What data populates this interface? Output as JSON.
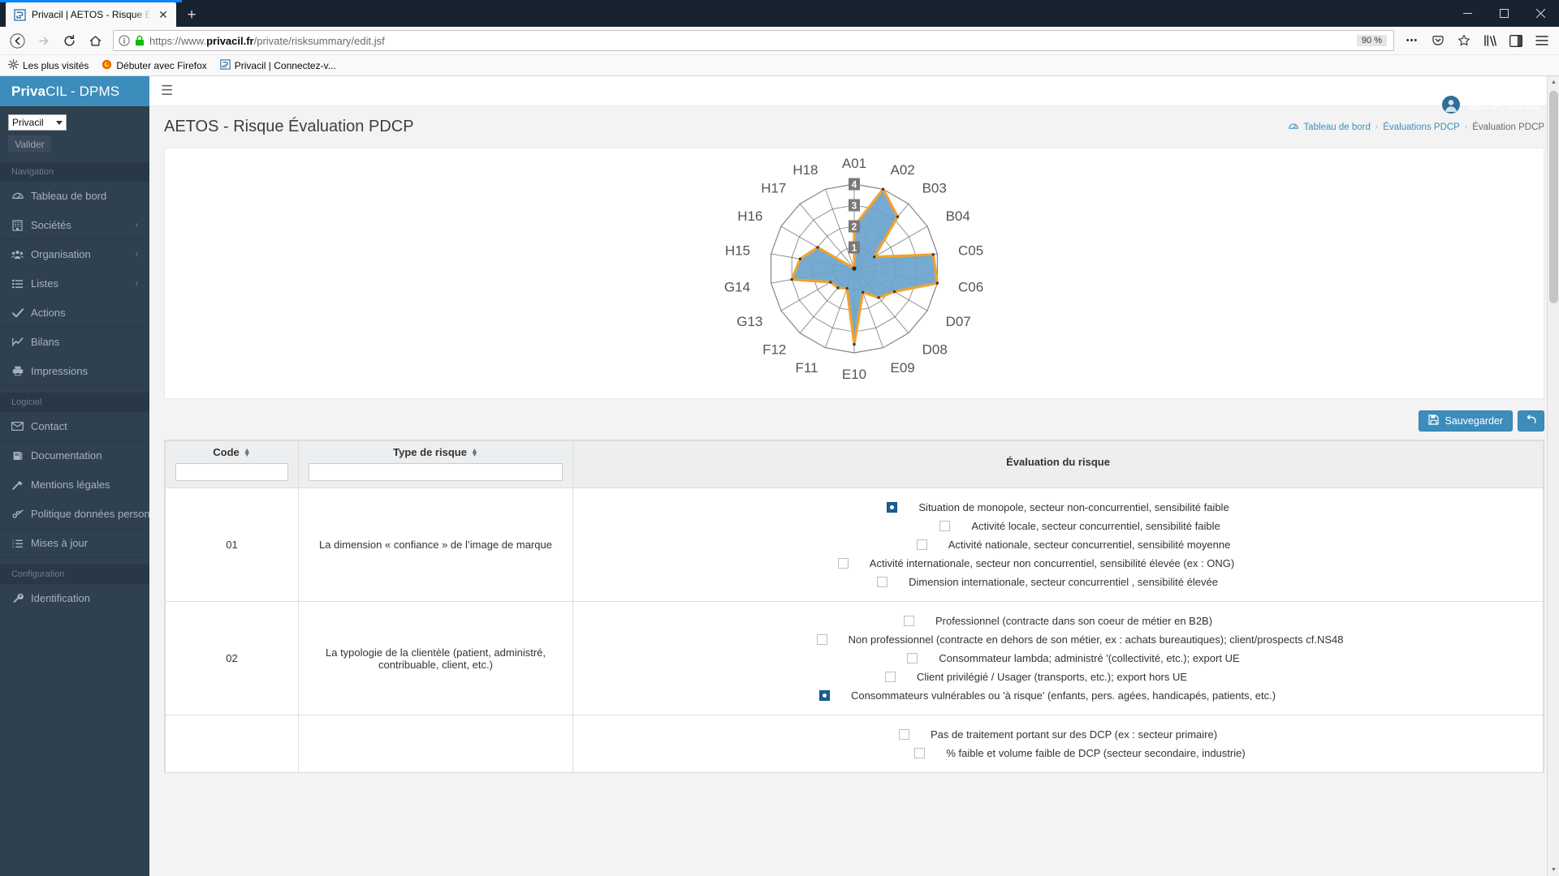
{
  "browser": {
    "tab": {
      "title": "Privacil | AETOS - Risque Évalua",
      "favicon_name": "privacil-favicon",
      "close_label": "✕"
    },
    "newtab_label": "+",
    "window_controls": {
      "minimize": "—",
      "maximize": "□",
      "close": "✕"
    },
    "nav": {
      "back": "←",
      "forward": "→",
      "reload": "⟳",
      "home": "⌂"
    },
    "url": {
      "prefix": "https://www.",
      "host": "privacil.fr",
      "path": "/private/risksummary/edit.jsf",
      "zoom": "90 %"
    },
    "toolbar_icons": {
      "more": "•••",
      "pocket": "pocket-icon",
      "star": "star-icon",
      "library": "library-icon",
      "sidebar": "sidebar-icon",
      "menu": "hamburger-menu-icon"
    },
    "bookmarks": [
      {
        "label": "Les plus visités",
        "icon": "gear-icon"
      },
      {
        "label": "Débuter avec Firefox",
        "icon": "firefox-icon"
      },
      {
        "label": "Privacil | Connectez-v...",
        "icon": "privacil-favicon"
      }
    ]
  },
  "app": {
    "brand": {
      "bold": "Priva",
      "light": "CIL - DPMS"
    },
    "hamburger": "☰",
    "user": {
      "name": "Mercier, Martial",
      "avatar": "user-avatar"
    },
    "page_title": "AETOS - Risque Évaluation PDCP",
    "breadcrumb": [
      {
        "label": "Tableau de bord",
        "icon": "dashboard-icon"
      },
      {
        "label": "Évaluations PDCP"
      },
      {
        "label": "Évaluation PDCP"
      }
    ],
    "breadcrumb_sep": "›"
  },
  "sidebar": {
    "company_select": {
      "value": "Privacil"
    },
    "validate_button": "Valider",
    "sections": [
      {
        "header": "Navigation",
        "items": [
          {
            "label": "Tableau de bord",
            "icon": "dashboard-icon",
            "chevron": ""
          },
          {
            "label": "Sociétés",
            "icon": "building-icon",
            "chevron": "‹"
          },
          {
            "label": "Organisation",
            "icon": "users-icon",
            "chevron": "‹"
          },
          {
            "label": "Listes",
            "icon": "list-icon",
            "chevron": "‹"
          },
          {
            "label": "Actions",
            "icon": "check-icon",
            "chevron": ""
          },
          {
            "label": "Bilans",
            "icon": "chart-line-icon",
            "chevron": ""
          },
          {
            "label": "Impressions",
            "icon": "printer-icon",
            "chevron": ""
          }
        ]
      },
      {
        "header": "Logiciel",
        "items": [
          {
            "label": "Contact",
            "icon": "envelope-icon",
            "chevron": ""
          },
          {
            "label": "Documentation",
            "icon": "book-icon",
            "chevron": ""
          },
          {
            "label": "Mentions légales",
            "icon": "hammer-icon",
            "chevron": ""
          },
          {
            "label": "Politique données personnelles",
            "icon": "link-icon",
            "chevron": ""
          },
          {
            "label": "Mises à jour",
            "icon": "list-ol-icon",
            "chevron": ""
          }
        ]
      },
      {
        "header": "Configuration",
        "items": [
          {
            "label": "Identification",
            "icon": "wrench-icon",
            "chevron": ""
          }
        ]
      }
    ]
  },
  "actions": {
    "save_label": "Sauvegarder",
    "save_icon": "save-icon",
    "undo_icon": "undo-icon"
  },
  "table": {
    "headers": {
      "code": "Code",
      "type": "Type de risque",
      "eval": "Évaluation du risque"
    },
    "filters": {
      "code": "",
      "type": ""
    },
    "rows": [
      {
        "code": "01",
        "type": "La dimension « confiance » de l’image de marque",
        "options": [
          {
            "label": "Situation de monopole, secteur non-concurrentiel, sensibilité faible",
            "checked": true,
            "indent": 0
          },
          {
            "label": "Activité locale, secteur concurrentiel, sensibilité faible",
            "checked": false,
            "indent": 1
          },
          {
            "label": "Activité nationale, secteur concurrentiel, sensibilité moyenne",
            "checked": false,
            "indent": 2
          },
          {
            "label": "Activité internationale, secteur non concurrentiel, sensibilité élevée (ex : ONG)",
            "checked": false,
            "indent": 3
          },
          {
            "label": "Dimension internationale, secteur concurrentiel , sensibilité élevée",
            "checked": false,
            "indent": 4
          }
        ]
      },
      {
        "code": "02",
        "type": "La typologie de la clientèle (patient, administré, contribuable, client, etc.)",
        "options": [
          {
            "label": "Professionnel (contracte dans son coeur de métier en B2B)",
            "checked": false,
            "indent": 0
          },
          {
            "label": "Non professionnel (contracte en dehors de son métier, ex : achats bureautiques); client/prospects cf.NS48",
            "checked": false,
            "indent": 1
          },
          {
            "label": "Consommateur lambda; administré '(collectivité, etc.); export UE",
            "checked": false,
            "indent": 2
          },
          {
            "label": "Client privilégié / Usager (transports, etc.); export hors UE",
            "checked": false,
            "indent": 3
          },
          {
            "label": "Consommateurs vulnérables ou 'à risque' (enfants, pers. agées, handicapés, patients, etc.)",
            "checked": true,
            "indent": 4
          }
        ]
      },
      {
        "code": "",
        "type": "",
        "options": [
          {
            "label": "Pas de traitement portant sur des DCP (ex : secteur primaire)",
            "checked": false,
            "indent": 0
          },
          {
            "label": "% faible et volume faible de DCP (secteur secondaire, industrie)",
            "checked": false,
            "indent": 1
          }
        ]
      }
    ]
  },
  "chart_data": {
    "type": "radar",
    "title": "",
    "categories": [
      "A01",
      "A02",
      "B03",
      "B04",
      "C05",
      "C06",
      "D07",
      "D08",
      "E09",
      "E10",
      "F11",
      "F12",
      "G13",
      "G14",
      "H15",
      "H16",
      "H17",
      "H18"
    ],
    "series": [
      {
        "name": "Évaluation du risque",
        "values": [
          2.0,
          4.0,
          3.2,
          1.1,
          3.8,
          4.0,
          2.2,
          1.8,
          1.2,
          3.6,
          1.0,
          1.2,
          1.3,
          3.0,
          2.6,
          2.0,
          0.0,
          0.0
        ]
      }
    ],
    "rings": [
      "1",
      "2",
      "3",
      "4"
    ],
    "rlim": [
      0,
      4
    ],
    "fill_color": "#6aa3cc",
    "line_color": "#efa32e",
    "grid_color": "#6d6d6d",
    "tick_badge_bg": "#7a7a7a",
    "legend": "none"
  }
}
